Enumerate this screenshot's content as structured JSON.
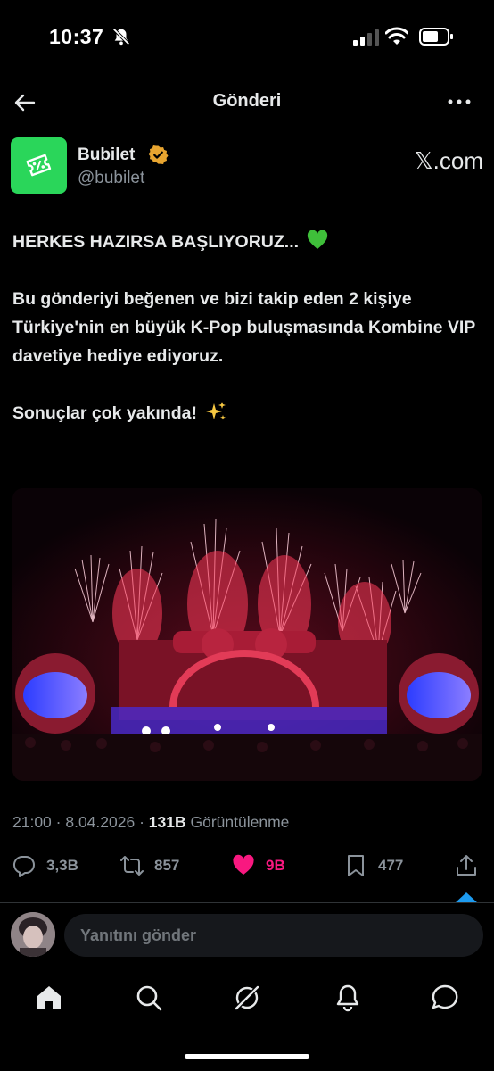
{
  "status_bar": {
    "time": "10:37"
  },
  "header": {
    "title": "Gönderi"
  },
  "author": {
    "name": "Bubilet",
    "handle": "@bubilet",
    "platform": "𝕏.com"
  },
  "tweet": {
    "line1": "HERKES HAZIRSA BAŞLIYORUZ... ",
    "line2": "Bu gönderiyi beğenen ve bizi takip eden 2 kişiye Türkiye'nin en büyük K-Pop buluşmasında Kombine VIP davetiye hediye ediyoruz.",
    "line3": "Sonuçlar çok yakında! ",
    "emoji_heart_color": "#3fbf3a"
  },
  "meta": {
    "time": "21:00",
    "date": "8.04.2026",
    "separator": " · ",
    "views_count": "131B",
    "views_label": "Görüntülenme"
  },
  "actions": {
    "replies": "3,3B",
    "retweets": "857",
    "likes": "9B",
    "bookmarks": "477"
  },
  "reply": {
    "placeholder": "Yanıtını gönder"
  },
  "colors": {
    "like": "#f91880",
    "verified": "#e8a530",
    "accent_blue": "#1d9bf0",
    "avatar_green": "#2ad65a"
  }
}
